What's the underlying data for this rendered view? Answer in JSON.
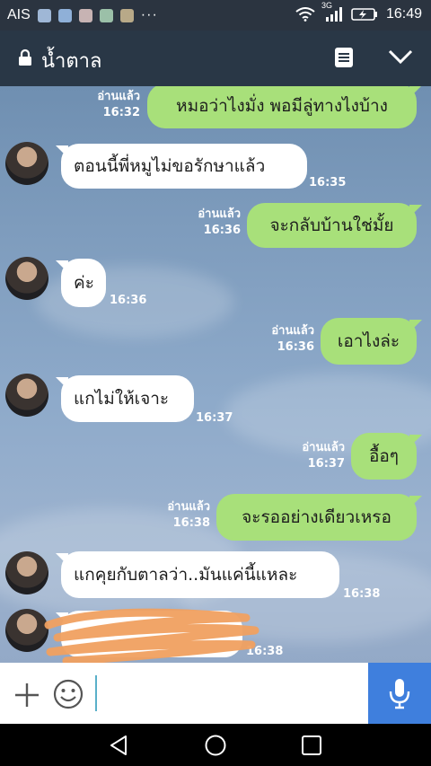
{
  "status_bar": {
    "carrier": "AIS",
    "network": "3G",
    "time": "16:49",
    "more": "···"
  },
  "header": {
    "title": "น้ำตาล",
    "icons": [
      "lock-icon",
      "memo-icon",
      "chevron-down-icon"
    ]
  },
  "messages": [
    {
      "dir": "out",
      "text": "หมอว่าไงมั่ง พอมีลู่ทางไงบ้าง",
      "read": "อ่านแล้ว",
      "time": "16:32"
    },
    {
      "dir": "in",
      "text": "ตอนนี้พี่หมูไม่ขอรักษาแล้ว",
      "time": "16:35"
    },
    {
      "dir": "out",
      "text": "จะกลับบ้านใช่มั้ย",
      "read": "อ่านแล้ว",
      "time": "16:36"
    },
    {
      "dir": "in",
      "text": "ค่ะ",
      "time": "16:36"
    },
    {
      "dir": "out",
      "text": "เอาไงล่ะ",
      "read": "อ่านแล้ว",
      "time": "16:36"
    },
    {
      "dir": "in",
      "text": "แกไม่ให้เจาะ",
      "time": "16:37"
    },
    {
      "dir": "out",
      "text": "อื้อๆ",
      "read": "อ่านแล้ว",
      "time": "16:37"
    },
    {
      "dir": "out",
      "text": "จะรออย่างเดียวเหรอ",
      "read": "อ่านแล้ว",
      "time": "16:38"
    },
    {
      "dir": "in",
      "text": "แกคุยกับตาลว่า..มันแค่นี้แหละ",
      "time": "16:38"
    },
    {
      "dir": "in",
      "text": "",
      "time": "16:38",
      "redacted": true
    }
  ],
  "colors": {
    "outgoing_bubble": "#a8e07a",
    "incoming_bubble": "#ffffff",
    "header": "#293746",
    "mic_button": "#3f7fdd",
    "scribble": "#f0a060"
  },
  "input_bar": {
    "icons": [
      "plus-icon",
      "emoji-icon",
      "microphone-icon"
    ]
  },
  "nav_bar": {
    "icons": [
      "back-icon",
      "home-icon",
      "recents-icon"
    ]
  }
}
